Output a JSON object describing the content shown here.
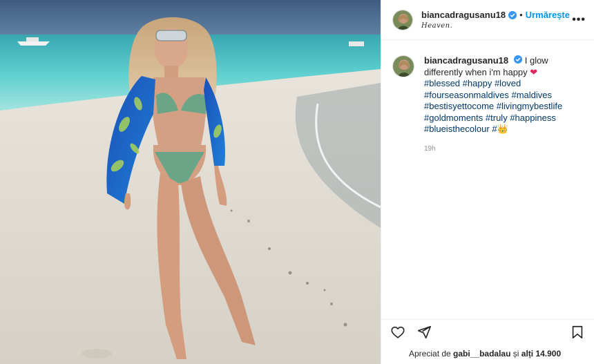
{
  "post": {
    "image_alt": "Woman in blue patterned shirt and green bikini on beach",
    "author": {
      "username": "biancadragusanu18",
      "verified": true,
      "follow_label": "Urmărește",
      "separator": "•",
      "location": "Heaven."
    },
    "more_label": "•••",
    "caption": {
      "username": "biancadragusanu18",
      "text": "I glow differently when i'm happy",
      "heart": "❤",
      "hashtags": [
        "#blessed",
        "#happy",
        "#loved",
        "#fourseasonmaldives",
        "#maldives",
        "#bestisyettocome",
        "#livingmybestlife",
        "#goldmoments",
        "#truly",
        "#happiness",
        "#blueisthecolour",
        "#"
      ],
      "crown": "👑",
      "timestamp": "19h"
    },
    "likes": {
      "prefix": "Apreciat de ",
      "user": "gabi__badalau",
      "middle": " și ",
      "others": "alți 14.900"
    },
    "colors": {
      "link": "#0095f6",
      "hashtag": "#00376b",
      "meta": "#8e8e8e"
    },
    "icons": [
      "heart-icon",
      "send-icon",
      "bookmark-icon",
      "verified-badge-icon",
      "more-options-icon"
    ]
  }
}
